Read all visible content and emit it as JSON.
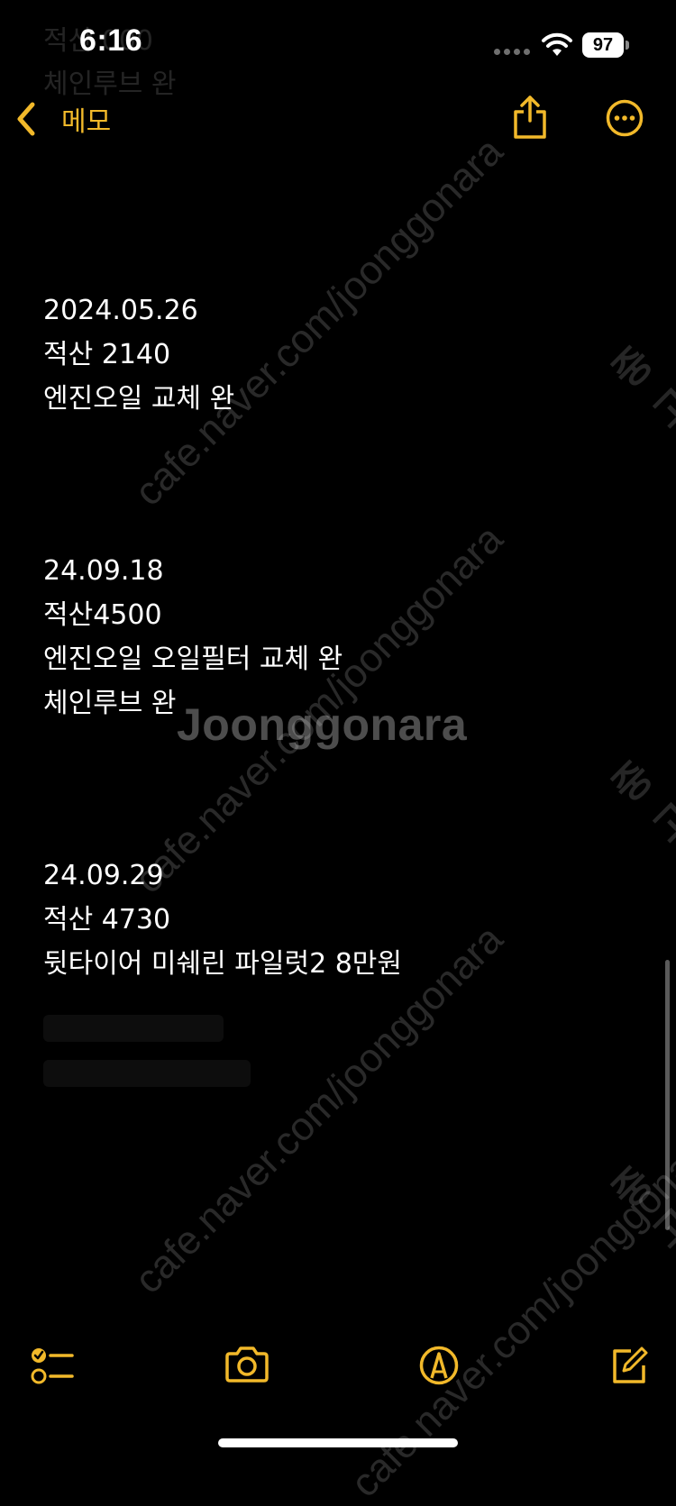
{
  "status_bar": {
    "time": "6:16",
    "battery": "97"
  },
  "nav": {
    "back_label": "메모"
  },
  "note": {
    "entries": [
      {
        "date": "2024.05.26",
        "mileage": "적산 2140",
        "lines": [
          "엔진오일 교체 완"
        ]
      },
      {
        "date": "24.09.18",
        "mileage": "적산4500",
        "lines": [
          "엔진오일 오일필터 교체 완",
          "체인루브 완"
        ]
      },
      {
        "date": "24.09.29",
        "mileage": "적산 4730",
        "lines": [
          "뒷타이어 미쉐린 파일럿2 8만원"
        ]
      }
    ]
  },
  "ghost_header": {
    "line1": "적산 000",
    "line2": "체인루브 완"
  },
  "watermark": {
    "brand": "Joonggonara",
    "url": "cafe.naver.com/joonggonara",
    "side_text": "중고"
  },
  "colors": {
    "accent": "#f2b92a",
    "background": "#000000",
    "text": "#ffffff"
  },
  "icons": {
    "back": "chevron-left-icon",
    "share": "share-icon",
    "more": "ellipsis-circle-icon",
    "checklist": "checklist-icon",
    "camera": "camera-icon",
    "markup": "pen-tip-circle-icon",
    "compose": "compose-icon"
  }
}
